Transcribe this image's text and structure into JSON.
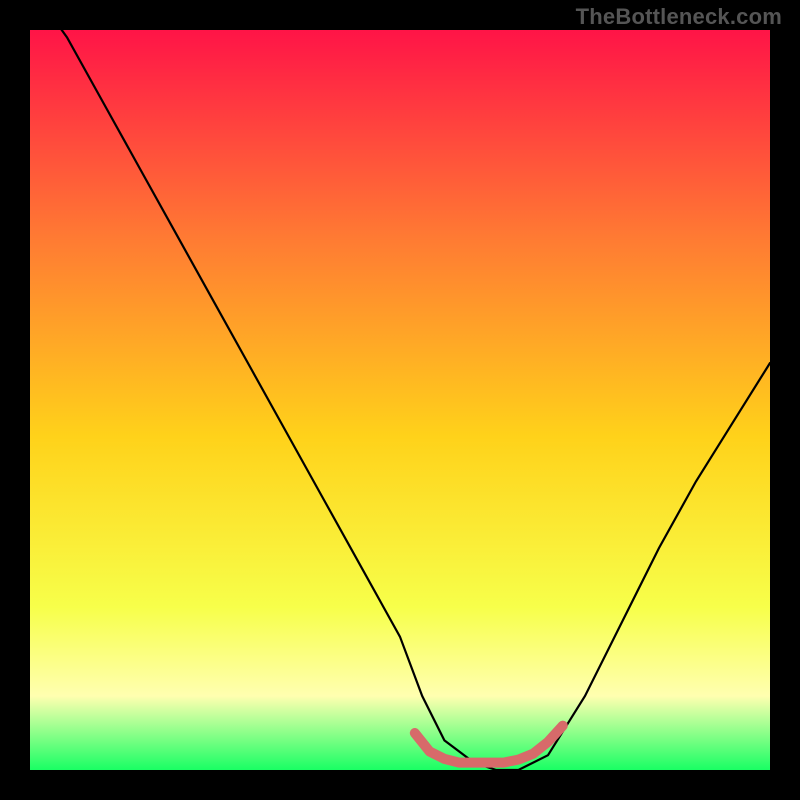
{
  "watermark": "TheBottleneck.com",
  "colors": {
    "bg_black": "#000000",
    "grad_top": "#ff1447",
    "grad_mid_upper": "#ff7a33",
    "grad_mid": "#ffd21a",
    "grad_low": "#f7ff4a",
    "grad_pale": "#ffffb0",
    "grad_green": "#19ff64",
    "curve": "#000000",
    "hump": "#d76a6a"
  },
  "chart_data": {
    "type": "line",
    "title": "",
    "xlabel": "",
    "ylabel": "",
    "xlim": [
      0,
      100
    ],
    "ylim": [
      0,
      100
    ],
    "grid": false,
    "legend": false,
    "annotations": [
      "TheBottleneck.com"
    ],
    "series": [
      {
        "name": "bottleneck-curve",
        "x": [
          0,
          5,
          10,
          15,
          20,
          25,
          30,
          35,
          40,
          45,
          50,
          53,
          56,
          60,
          63,
          66,
          70,
          75,
          80,
          85,
          90,
          95,
          100
        ],
        "values": [
          106,
          99,
          90,
          81,
          72,
          63,
          54,
          45,
          36,
          27,
          18,
          10,
          4,
          1,
          0,
          0,
          2,
          10,
          20,
          30,
          39,
          47,
          55
        ]
      },
      {
        "name": "optimal-hump",
        "x": [
          52,
          54,
          56,
          58,
          60,
          62,
          64,
          66,
          68,
          70,
          72
        ],
        "values": [
          5,
          2.5,
          1.5,
          1,
          1,
          1,
          1,
          1.4,
          2.2,
          3.8,
          6
        ]
      }
    ],
    "description": "V-shaped bottleneck curve over a vertical red-to-green gradient; minimum (optimal match) around x≈63–66 at y≈0 with a small salmon hump marking the near-zero region."
  }
}
